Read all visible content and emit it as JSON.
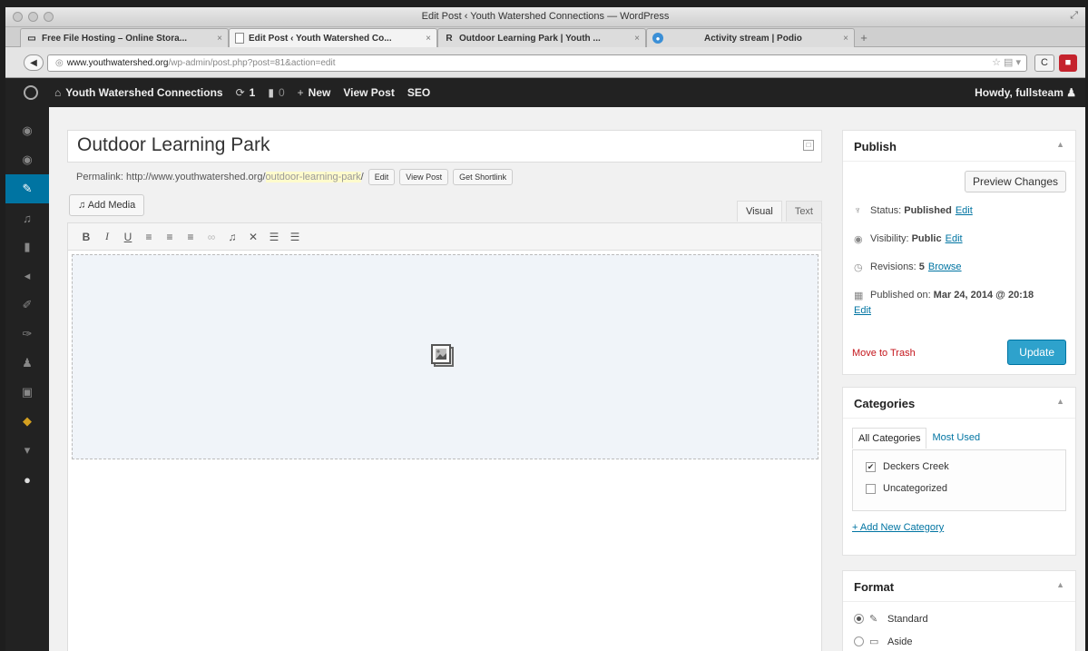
{
  "window": {
    "title": "Edit Post ‹ Youth Watershed Connections — WordPress"
  },
  "tabs": [
    {
      "label": "Free File Hosting – Online Stora...",
      "favicon": "folder-icon"
    },
    {
      "label": "Edit Post ‹ Youth Watershed Co...",
      "favicon": "page-icon"
    },
    {
      "label": "Outdoor Learning Park | Youth ...",
      "favicon": "R"
    },
    {
      "label": "Activity stream | Podio",
      "favicon": "podio-icon"
    }
  ],
  "address": {
    "domain": "www.youthwatershed.org",
    "path": "/wp-admin/post.php?post=81&action=edit"
  },
  "adminbar": {
    "site": "Youth Watershed Connections",
    "updates": "1",
    "comments": "0",
    "new": "New",
    "view_post": "View Post",
    "seo": "SEO",
    "howdy": "Howdy, fullsteam"
  },
  "editor": {
    "post_title": "Outdoor Learning Park",
    "permalink_label": "Permalink:",
    "permalink_base": "http://www.youthwatershed.org/",
    "permalink_slug": "outdoor-learning-park",
    "permalink_tail": "/",
    "edit_btn": "Edit",
    "view_post_btn": "View Post",
    "shortlink_btn": "Get Shortlink",
    "add_media": "Add Media",
    "tab_visual": "Visual",
    "tab_text": "Text"
  },
  "publish": {
    "heading": "Publish",
    "preview": "Preview Changes",
    "status_label": "Status:",
    "status_value": "Published",
    "visibility_label": "Visibility:",
    "visibility_value": "Public",
    "revisions_label": "Revisions:",
    "revisions_value": "5",
    "browse": "Browse",
    "published_label": "Published on:",
    "published_value": "Mar 24, 2014 @ 20:18",
    "edit": "Edit",
    "trash": "Move to Trash",
    "update": "Update"
  },
  "categories": {
    "heading": "Categories",
    "tab_all": "All Categories",
    "tab_most": "Most Used",
    "items": [
      {
        "label": "Deckers Creek",
        "checked": true
      },
      {
        "label": "Uncategorized",
        "checked": false
      }
    ],
    "add_new": "+ Add New Category"
  },
  "format": {
    "heading": "Format",
    "options": [
      {
        "label": "Standard",
        "selected": true
      },
      {
        "label": "Aside",
        "selected": false
      }
    ]
  },
  "colors": {
    "wp_blue": "#0074a2",
    "update_btn": "#2ea2cc",
    "trash_red": "#c4161c",
    "admin_bar": "#222222"
  }
}
